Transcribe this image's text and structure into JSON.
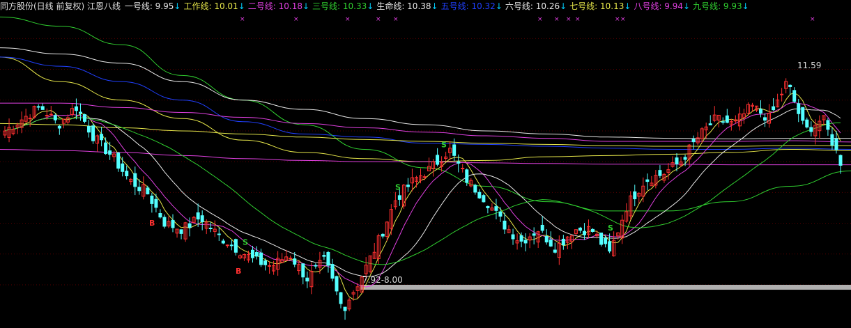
{
  "header": {
    "title": "同方股份(日线 前复权) 江恩八线",
    "title_color": "#dcdcdc",
    "down_arrow": "↓",
    "arrow_color": "#00d0ff",
    "lines": [
      {
        "label": "一号线: 9.95",
        "color": "#e8e8e8"
      },
      {
        "label": "工作线: 10.01",
        "color": "#e6e64a"
      },
      {
        "label": "二号线: 10.18",
        "color": "#e040e0"
      },
      {
        "label": "三号线: 10.33",
        "color": "#30d030"
      },
      {
        "label": "生命线: 10.38",
        "color": "#e8e8e8"
      },
      {
        "label": "五号线: 10.32",
        "color": "#2040ff"
      },
      {
        "label": "六号线: 10.26",
        "color": "#e8e8e8"
      },
      {
        "label": "七号线: 10.13",
        "color": "#e6e64a"
      },
      {
        "label": "八号线: 9.94",
        "color": "#e040e0"
      },
      {
        "label": "九号线: 9.93",
        "color": "#30d030"
      }
    ]
  },
  "annotations": {
    "high_label": "11.59",
    "support_label": "7.92-8.00",
    "buy_marker": "B",
    "sell_marker": "S",
    "cross_marker": "×"
  },
  "colors": {
    "up_candle": "#ff3030",
    "down_candle": "#54ffff",
    "grid": "#5a0000",
    "support_band": "#b0b0b0"
  },
  "chart_data": {
    "type": "candlestick",
    "title": "同方股份(日线 前复权) 江恩八线",
    "y_range": [
      7.4,
      12.4
    ],
    "high": 11.59,
    "support_band": [
      7.92,
      8.0
    ],
    "series": [
      {
        "name": "一号线",
        "last": 9.95,
        "color": "#e8e8e8",
        "kind": "line"
      },
      {
        "name": "工作线",
        "last": 10.01,
        "color": "#e6e64a",
        "kind": "line"
      },
      {
        "name": "二号线",
        "last": 10.18,
        "color": "#e040e0",
        "kind": "line"
      },
      {
        "name": "三号线",
        "last": 10.33,
        "color": "#30d030",
        "kind": "line"
      },
      {
        "name": "生命线",
        "last": 10.38,
        "color": "#e8e8e8",
        "kind": "line"
      },
      {
        "name": "五号线",
        "last": 10.32,
        "color": "#2040ff",
        "kind": "line"
      },
      {
        "name": "六号线",
        "last": 10.26,
        "color": "#e8e8e8",
        "kind": "line"
      },
      {
        "name": "七号线",
        "last": 10.13,
        "color": "#e6e64a",
        "kind": "line"
      },
      {
        "name": "八号线",
        "last": 9.94,
        "color": "#e040e0",
        "kind": "line"
      },
      {
        "name": "九号线",
        "last": 9.93,
        "color": "#30d030",
        "kind": "line"
      }
    ],
    "price_path": [
      10.5,
      10.7,
      10.9,
      10.6,
      10.9,
      10.4,
      10.1,
      9.7,
      9.5,
      9.0,
      8.9,
      9.1,
      8.8,
      8.6,
      8.4,
      8.3,
      8.5,
      8.1,
      8.4,
      7.6,
      8.1,
      8.7,
      9.4,
      9.7,
      9.9,
      10.2,
      9.7,
      9.4,
      9.0,
      8.7,
      8.9,
      8.6,
      8.9,
      8.9,
      8.5,
      9.3,
      9.7,
      9.8,
      10.0,
      10.4,
      10.7,
      10.6,
      10.9,
      10.7,
      11.3,
      10.5,
      10.7,
      10.0
    ],
    "trend_lines": [
      [
        11.7,
        11.3,
        11.0,
        10.7,
        10.35,
        10.15,
        10.05,
        10.0,
        10.02,
        10.08,
        10.1,
        10.12,
        10.15,
        10.2,
        10.18
      ],
      [
        11.7,
        11.55,
        11.3,
        11.0,
        10.65,
        10.45,
        10.4,
        10.3,
        10.28,
        10.25,
        10.22,
        10.2,
        10.2,
        10.22,
        10.2
      ],
      [
        12.35,
        12.2,
        11.9,
        11.4,
        11.0,
        10.6,
        10.2,
        9.9,
        9.6,
        9.35,
        9.2,
        9.2,
        9.35,
        9.6,
        9.85
      ],
      [
        10.95,
        10.95,
        10.88,
        10.8,
        10.72,
        10.62,
        10.55,
        10.48,
        10.42,
        10.38,
        10.33,
        10.33,
        10.33,
        10.34,
        10.32
      ],
      [
        10.62,
        10.6,
        10.55,
        10.5,
        10.45,
        10.4,
        10.36,
        10.33,
        10.3,
        10.28,
        10.26,
        10.25,
        10.25,
        10.26,
        10.26
      ],
      [
        11.85,
        11.75,
        11.6,
        11.3,
        11.0,
        10.85,
        10.7,
        10.6,
        10.5,
        10.45,
        10.4,
        10.38,
        10.37,
        10.38,
        10.38
      ],
      [
        10.2,
        10.18,
        10.15,
        10.1,
        10.05,
        10.02,
        10.0,
        10.0,
        9.98,
        9.97,
        9.96,
        9.96,
        9.95,
        9.95,
        9.95
      ]
    ]
  }
}
